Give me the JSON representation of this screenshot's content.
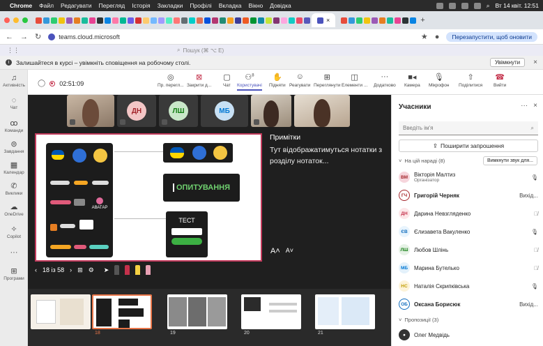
{
  "menubar": {
    "app": "Chrome",
    "items": [
      "Файл",
      "Редагувати",
      "Перегляд",
      "Історія",
      "Закладки",
      "Профілі",
      "Вкладка",
      "Вікно",
      "Довідка"
    ],
    "clock": "Вт 14 квіт. 12:51"
  },
  "browser": {
    "url": "teams.cloud.microsoft",
    "relaunch": "Перезапустити, щоб оновити"
  },
  "teams": {
    "search_placeholder": "Пошук (⌘ ⌥ E)"
  },
  "notification": {
    "text": "Залишайтеся в курсі – увімкніть сповіщення на робочому столі.",
    "enable": "Увімкнути"
  },
  "rail": [
    "Активність",
    "Чат",
    "Команди",
    "Завдання",
    "Календар",
    "Виклики",
    "OneDrive",
    "Copilot",
    "Програми"
  ],
  "toolbar": {
    "timer": "02:51:09",
    "buttons": [
      {
        "label": "Пр. перегл...",
        "icon": "eye-icon"
      },
      {
        "label": "Закрити д...",
        "icon": "close-share-icon"
      },
      {
        "label": "Чат",
        "icon": "chat-icon"
      },
      {
        "label": "Користувачі",
        "icon": "people-icon",
        "badge": "8"
      },
      {
        "label": "Підняти",
        "icon": "raise-hand-icon"
      },
      {
        "label": "Реагувати",
        "icon": "emoji-icon"
      },
      {
        "label": "Переглянути",
        "icon": "view-icon"
      },
      {
        "label": "Елементи ...",
        "icon": "apps-icon"
      },
      {
        "label": "Додатково",
        "icon": "more-icon"
      },
      {
        "label": "Камера",
        "icon": "camera-icon"
      },
      {
        "label": "Мікрофон",
        "icon": "mic-icon"
      },
      {
        "label": "Поділитися",
        "icon": "share-icon"
      },
      {
        "label": "Вийти",
        "icon": "leave-icon"
      }
    ]
  },
  "tiles": [
    {
      "type": "video"
    },
    {
      "type": "avatar",
      "initials": "ДН"
    },
    {
      "type": "avatar",
      "initials": "ЛШ"
    },
    {
      "type": "avatar",
      "initials": "МБ"
    },
    {
      "type": "video"
    },
    {
      "type": "video"
    }
  ],
  "slide": {
    "label_poll": "ОПИТУВАННЯ",
    "label_test": "ТЕСТ",
    "label_avatar": "АВАТАР"
  },
  "notes": {
    "title": "Примітки",
    "body": "Тут відображатимуться нотатки з розділу нотаток..."
  },
  "slide_nav": {
    "position": "18 із 58"
  },
  "thumbnails": [
    {
      "num": "18",
      "selected": true
    },
    {
      "num": "19",
      "selected": false
    },
    {
      "num": "20",
      "selected": false
    },
    {
      "num": "21",
      "selected": false
    }
  ],
  "panel": {
    "title": "Учасники",
    "search_placeholder": "Введіть ім'я",
    "invite": "Поширити запрошення",
    "in_meeting": "На цій нараді (8)",
    "mute_all": "Вимкнути звук для...",
    "suggestions": "Пропозиції (3)",
    "participants": [
      {
        "initials": "ВМ",
        "name": "Вікторія Малтиз",
        "role": "Організатор",
        "status": "mic",
        "bg": "#f6d5dc",
        "fg": "#a4262c"
      },
      {
        "initials": "ГЧ",
        "name": "Григорій Черняк",
        "role": "",
        "status": "Вихід...",
        "bg": "#fff",
        "fg": "#a4262c",
        "ring": true
      },
      {
        "initials": "ДН",
        "name": "Дарина Невзгляденко",
        "role": "",
        "status": "muted",
        "bg": "#fde7e9",
        "fg": "#c4314b"
      },
      {
        "initials": "ЄВ",
        "name": "Єлизавета Вакуленко",
        "role": "",
        "status": "mic",
        "bg": "#e8f4fd",
        "fg": "#0f6cbd"
      },
      {
        "initials": "ЛШ",
        "name": "Любов Шлінь",
        "role": "",
        "status": "muted",
        "bg": "#e6f2e6",
        "fg": "#107c10"
      },
      {
        "initials": "МБ",
        "name": "Марина Бутелько",
        "role": "",
        "status": "muted",
        "bg": "#e3f1fb",
        "fg": "#0078d4"
      },
      {
        "initials": "НС",
        "name": "Наталія Скрипківська",
        "role": "",
        "status": "mic",
        "bg": "#fdf3d8",
        "fg": "#c19c00"
      },
      {
        "initials": "ОБ",
        "name": "Оксана Борисюк",
        "role": "",
        "status": "Вихід...",
        "bg": "#fff",
        "fg": "#0f6cbd",
        "ring": true
      }
    ],
    "suggested": [
      {
        "name": "Олег Медвідь"
      }
    ]
  }
}
